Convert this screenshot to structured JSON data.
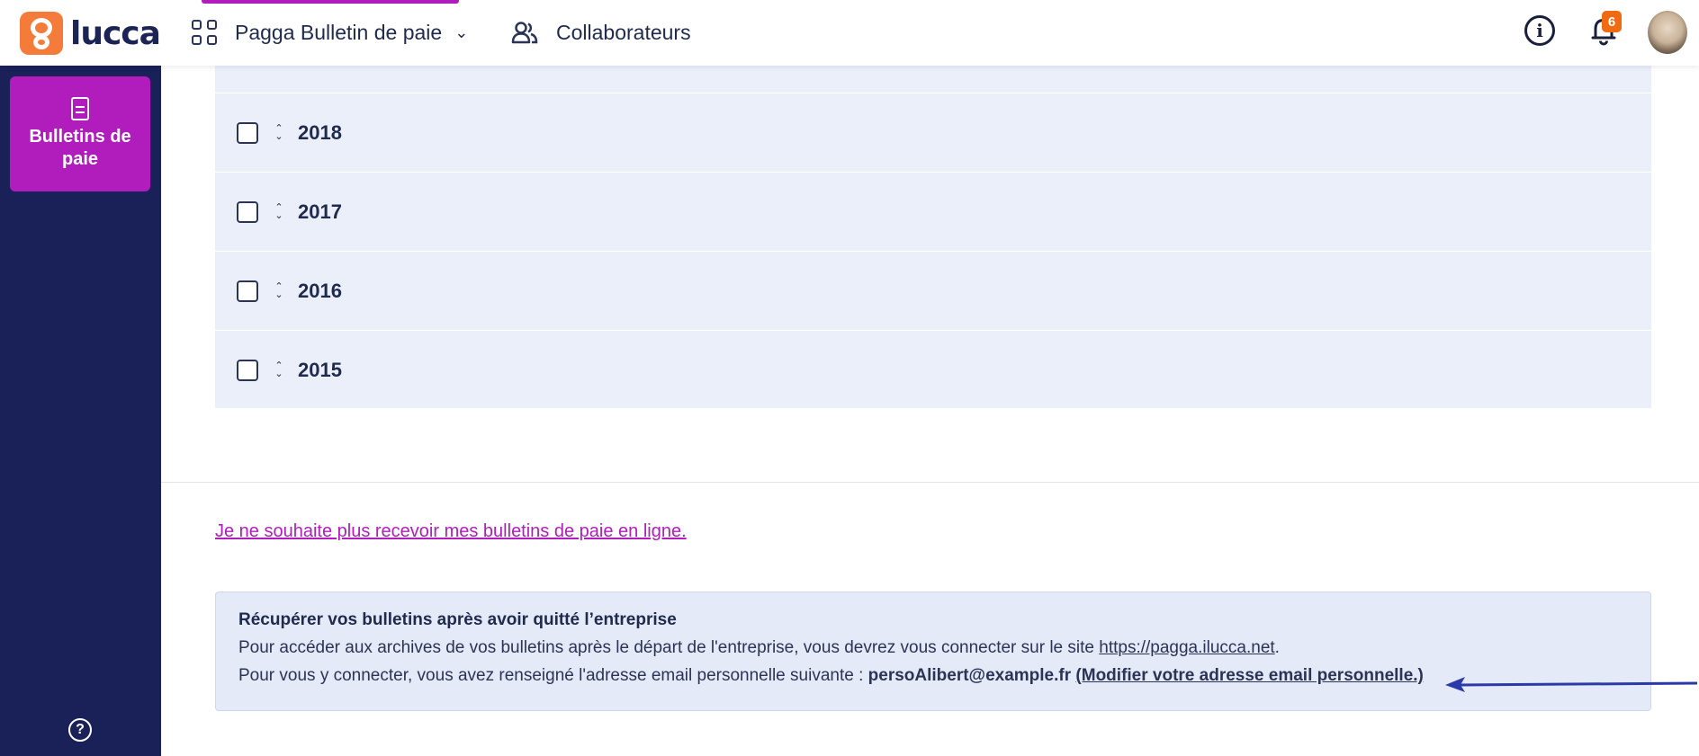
{
  "brand": {
    "name": "lucca",
    "accent": "#b11dbd",
    "navy": "#1a2158",
    "orange": "#f47b3a"
  },
  "header": {
    "app_name": "Pagga Bulletin de paie",
    "people_label": "Collaborateurs",
    "notification_count": "6",
    "icons": [
      "apps-grid-icon",
      "chevron-down-icon",
      "people-icon",
      "info-icon",
      "bell-icon"
    ]
  },
  "sidebar": {
    "items": [
      {
        "label": "Bulletins de paie",
        "icon": "document-icon"
      }
    ],
    "help_icon": "help-icon"
  },
  "years": [
    "2018",
    "2017",
    "2016",
    "2015"
  ],
  "optout_link": "Je ne souhaite plus recevoir mes bulletins de paie en ligne.",
  "info_box": {
    "title": "Récupérer vos bulletins après avoir quitté l’entreprise",
    "line1_prefix": "Pour accéder aux archives de vos bulletins après le départ de l'entreprise, vous devrez vous connecter sur le site ",
    "line1_link": "https://pagga.ilucca.net",
    "line1_suffix": ".",
    "line2_prefix": "Pour vous y connecter, vous avez renseigné l'adresse email personnelle suivante : ",
    "email": "persoAlibert@example.fr",
    "modify_link": "(Modifier votre adresse email personnelle.)"
  }
}
